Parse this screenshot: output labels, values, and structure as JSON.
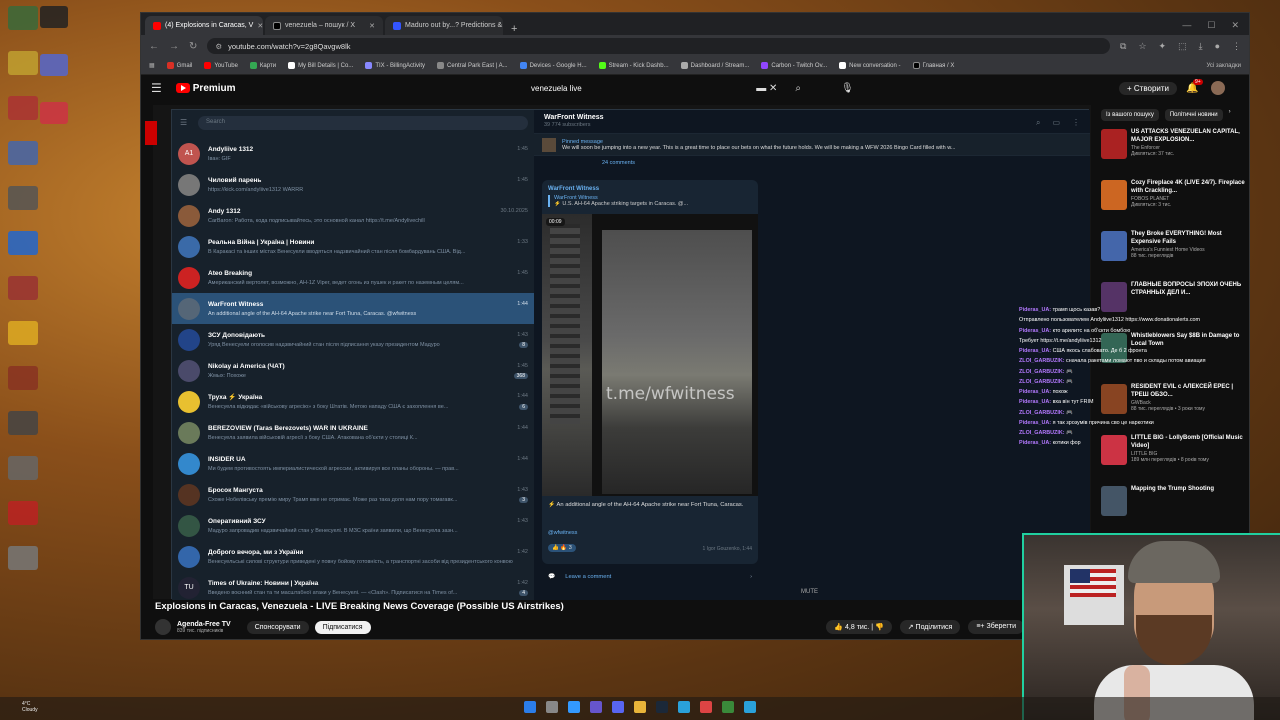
{
  "browser": {
    "tabs": [
      {
        "label": "(4) Explosions in Caracas, V",
        "color": "#ff0000",
        "active": true
      },
      {
        "label": "venezuela – пошук / X",
        "color": "#000000",
        "active": false
      },
      {
        "label": "Maduro out by...? Predictions &",
        "color": "#3355ff",
        "active": false
      }
    ],
    "new_tab": "+",
    "url": "youtube.com/watch?v=2g8Qavgw8lk",
    "bookmarks": [
      {
        "label": "Gmail",
        "color": "#d93025"
      },
      {
        "label": "YouTube",
        "color": "#ff0000"
      },
      {
        "label": "Карти",
        "color": "#34a853"
      },
      {
        "label": "My Bill Details | Co...",
        "color": "#ffffff"
      },
      {
        "label": "TIX - BillingActivity",
        "color": "#8888ff"
      },
      {
        "label": "Central Park East | A...",
        "color": "#888888"
      },
      {
        "label": "Devices - Google H...",
        "color": "#4285f4"
      },
      {
        "label": "Stream - Kick Dashb...",
        "color": "#53fc18"
      },
      {
        "label": "Dashboard / Stream...",
        "color": "#aaaaaa"
      },
      {
        "label": "Carbon - Twitch Ov...",
        "color": "#9146ff"
      },
      {
        "label": "New conversation -",
        "color": "#ffffff"
      },
      {
        "label": "Главная / X",
        "color": "#000000"
      }
    ],
    "bookmarks_right": "Усі закладки"
  },
  "youtube": {
    "logo": "Premium",
    "search_value": "venezuela live",
    "create_label": "Створити",
    "bell_count": "9+"
  },
  "telegram": {
    "search_placeholder": "Search",
    "chats": [
      {
        "avatar": "A1",
        "color": "#c0544f",
        "name": "Andyliive 1312",
        "time": "1:45",
        "preview": "Іван: GIF",
        "badge": ""
      },
      {
        "avatar": "",
        "color": "#777777",
        "name": "Чиловий парень",
        "time": "1:45",
        "preview": "https://kick.com/andyliive1312 WARRR",
        "badge": ""
      },
      {
        "avatar": "",
        "color": "#8a5a3a",
        "name": "Andy 1312",
        "time": "30.10.2025",
        "preview": "CarBaron: Работа, кода подписывайтесь, это основной канал https://t.me/Andylivechill",
        "badge": ""
      },
      {
        "avatar": "",
        "color": "#3a6aa8",
        "name": "Реальна Війна | Україна | Новини",
        "time": "1:33",
        "preview": "В Каракасі та інших містах Венесуели вводяться надзвичайний стан після бомбардувань США. Від...",
        "badge": ""
      },
      {
        "avatar": "",
        "color": "#cc2222",
        "name": "Ateo Breaking",
        "time": "1:45",
        "preview": "Американский вертолет, возможно, AH-1Z Viper, ведет огонь из пушек и ракет по наземным целям...",
        "badge": ""
      },
      {
        "avatar": "",
        "color": "#556677",
        "name": "WarFront Witness",
        "time": "1:44",
        "preview": "An additional angle of the AH-64 Apache strike near Fort Tiuna, Caracas. @wfwitness",
        "badge": ""
      },
      {
        "avatar": "",
        "color": "#224488",
        "name": "ЗСУ Доповідають",
        "time": "1:43",
        "preview": "Уряд Венесуели оголосив надзвичайний стан після підписання указу президентом Мадуро",
        "badge": "8"
      },
      {
        "avatar": "",
        "color": "#4a4a6a",
        "name": "Nikolay ai America (ЧАТ)",
        "time": "1:45",
        "preview": "Жмых: Похоже",
        "badge": "368"
      },
      {
        "avatar": "",
        "color": "#e8c030",
        "name": "Труха ⚡ Україна",
        "time": "1:44",
        "preview": "Венесуела відкидає «військову агресію» з боку Штатів. Метою нападу США є захоплення ве...",
        "badge": "6"
      },
      {
        "avatar": "",
        "color": "#6a7a5a",
        "name": "BEREZOVIEW (Taras Berezovets) WAR IN UKRAINE",
        "time": "1:44",
        "preview": "Венесуела заявила військовій агресії з боку США. Атакована об'єкти у столиці К...",
        "badge": ""
      },
      {
        "avatar": "",
        "color": "#3388cc",
        "name": "INSIDER UA",
        "time": "1:44",
        "preview": "Ми будем противостоять империалистической агрессии, активируя все планы обороны. — прав...",
        "badge": ""
      },
      {
        "avatar": "",
        "color": "#553322",
        "name": "Бросок Мангуста",
        "time": "1:43",
        "preview": "Схоже Нобелівську премію миру Трамп вже не отримає. Може раз така доля нам пору томагавк...",
        "badge": "3"
      },
      {
        "avatar": "",
        "color": "#335544",
        "name": "Оперативний ЗСУ",
        "time": "1:43",
        "preview": "Мадуро запровадив надзвичайний стан у Венесуелі. В МЗС країни заявили, що Венесуела зазн...",
        "badge": ""
      },
      {
        "avatar": "",
        "color": "#3366aa",
        "name": "Доброго вечора, ми з України",
        "time": "1:42",
        "preview": "Венесуельські силові структури приведені у повну бойову готовність, а транспортні засоби від президентського конвою",
        "badge": ""
      },
      {
        "avatar": "TU",
        "color": "#222233",
        "name": "Times of Ukraine: Новини | Україна",
        "time": "1:42",
        "preview": "Введено воєнний стан та ти масштабної атаки у Венесуелі. — «Clash». Підписатися на Times of...",
        "badge": "4"
      }
    ],
    "channel": {
      "name": "WarFront Witness",
      "subscribers": "39 774 subscribers",
      "pinned_title": "Pinned message",
      "pinned_text": "We will soon be jumping into a new year. This is a great time to place our bets on what the future holds. We will be making a WFW 2026 Bingo Card filled with w...",
      "comments": "24 comments",
      "post_channel": "WarFront Witness",
      "fwd_name": "WarFront Witness",
      "fwd_text": "⚡ U.S. AH-64 Apache striking targets in Caracas. @...",
      "video_time": "00:09",
      "watermark": "t.me/wfwitness",
      "caption": "⚡ An additional angle of the AH-64 Apache strike near Fort Tiuna, Caracas.",
      "tag": "@wfwitness",
      "reactions": "3",
      "meta": "1  Igor Gouzenko, 1:44",
      "leave_comment": "Leave a comment"
    }
  },
  "live_chat": [
    {
      "name": "Pideras_UA:",
      "text": "трамп щось казав?"
    },
    {
      "name": "",
      "text": "Отправлено пользователем Andyliive1312 https://www.donationalerts.com"
    },
    {
      "name": "Pideras_UA:",
      "text": "кто арилитс на об'єкти бомбою"
    },
    {
      "name": "",
      "text": "Требует https://t.me/andyliive1312"
    },
    {
      "name": "Pideras_UA:",
      "text": "США якось слабовато. Де б 2 фронта"
    },
    {
      "name": "ZLOI_GARBUZIK:",
      "text": "сначала ракетами ломают пво и склады потом авиация"
    },
    {
      "name": "ZLOI_GARBUZIK:",
      "text": "🎮"
    },
    {
      "name": "ZLOI_GARBUZIK:",
      "text": "🎮"
    },
    {
      "name": "Pideras_UA:",
      "text": "похож"
    },
    {
      "name": "Pideras_UA:",
      "text": "вха він тут FRIM"
    },
    {
      "name": "ZLOI_GARBUZIK:",
      "text": "🎮"
    },
    {
      "name": "Pideras_UA:",
      "text": "я так зрозумів причина сво це наркотики"
    },
    {
      "name": "ZLOI_GARBUZIK:",
      "text": "🎮"
    },
    {
      "name": "Pideras_UA:",
      "text": "котики фор"
    }
  ],
  "recs": {
    "chips": [
      "Із вашого пошуку",
      "Політичні новини"
    ],
    "items": [
      {
        "title": "US ATTACKS VENEZUELAN CAPITAL, MAJOR EXPLOSION...",
        "channel": "The Enforcer",
        "meta": "Дивляться: 37 тис.",
        "color": "#aa2222"
      },
      {
        "title": "Cozy Fireplace 4K (LIVE 24/7). Fireplace with Crackling...",
        "channel": "FOBOS PLANET",
        "meta": "Дивляться: 3 тис.",
        "color": "#cc6622"
      },
      {
        "title": "They Broke EVERYTHING! Most Expensive Fails",
        "channel": "America's Funniest Home Videos",
        "meta": "88 тис. переглядів",
        "color": "#4466aa"
      },
      {
        "title": "ГЛАВНЫЕ ВОПРОСЫ ЭПОХИ ОЧЕНЬ СТРАННЫХ ДЕЛ И...",
        "channel": "",
        "meta": "",
        "color": "#553366"
      },
      {
        "title": "Whistleblowers Say $8B in Damage to Local Town",
        "channel": "",
        "meta": "",
        "color": "#336655"
      },
      {
        "title": "RESIDENT EVIL с АЛЕКСЕЙ ЕРЕС | ТРЕШ ОБЗО...",
        "channel": "GWBack",
        "meta": "88 тис. переглядів • 3 роки тому",
        "color": "#884422"
      },
      {
        "title": "LITTLE BIG - LollyBomb [Official Music Video]",
        "channel": "LITTLE BIG",
        "meta": "189 млн переглядів • 8 років тому",
        "color": "#cc3344"
      },
      {
        "title": "Mapping the Trump Shooting",
        "channel": "",
        "meta": "",
        "color": "#445566"
      }
    ]
  },
  "video": {
    "title": "Explosions in Caracas, Venezuela - LIVE Breaking News Coverage (Possible US Airstrikes)",
    "channel": "Agenda-Free TV",
    "subs": "839 тис. підписників",
    "sponsor": "Спонсорувати",
    "subscribe": "Підписатися",
    "likes": "4,8 тис.",
    "share": "Поділитися",
    "save": "Зберегти",
    "mute": "MUTE"
  },
  "weather": {
    "temp": "4°C",
    "desc": "Cloudy"
  }
}
